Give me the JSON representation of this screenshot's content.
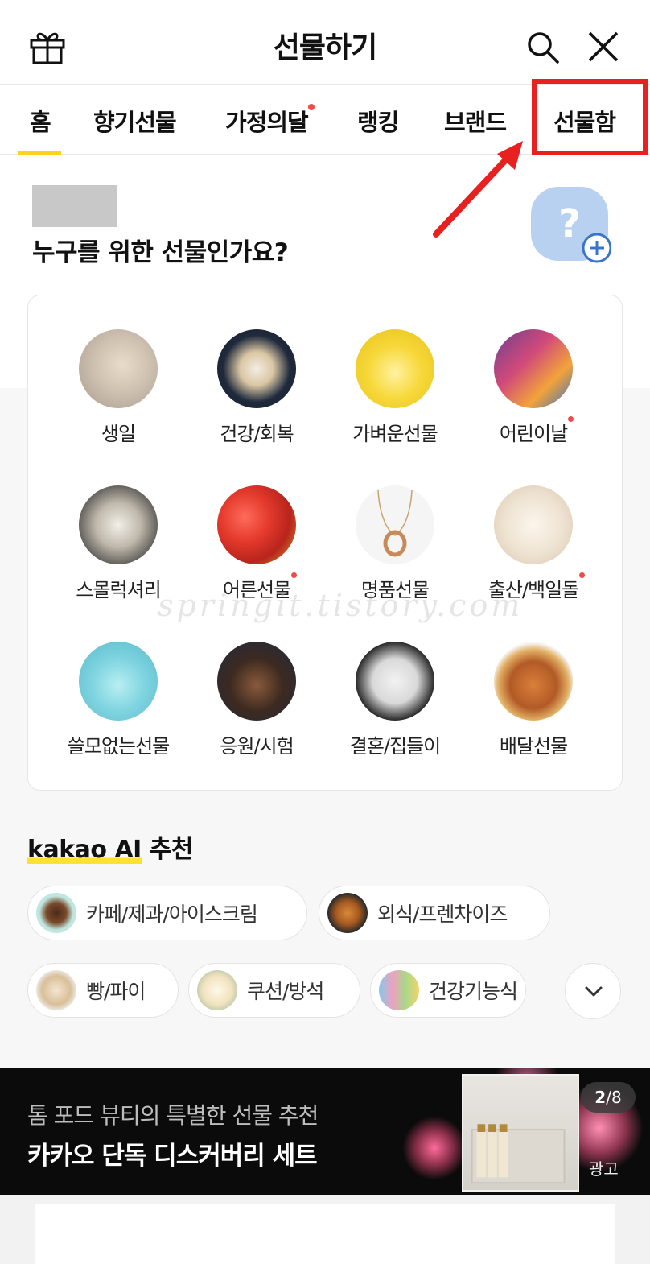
{
  "header": {
    "title": "선물하기"
  },
  "tabs": [
    {
      "label": "홈"
    },
    {
      "label": "향기선물"
    },
    {
      "label": "가정의달"
    },
    {
      "label": "랭킹"
    },
    {
      "label": "브랜드"
    },
    {
      "label": "선물함"
    }
  ],
  "who": {
    "question": "누구를 위한 선물인가요?"
  },
  "categories": [
    {
      "label": "생일"
    },
    {
      "label": "건강/회복"
    },
    {
      "label": "가벼운선물"
    },
    {
      "label": "어린이날"
    },
    {
      "label": "스몰럭셔리"
    },
    {
      "label": "어른선물"
    },
    {
      "label": "명품선물"
    },
    {
      "label": "출산/백일돌"
    },
    {
      "label": "쓸모없는선물"
    },
    {
      "label": "응원/시험"
    },
    {
      "label": "결혼/집들이"
    },
    {
      "label": "배달선물"
    }
  ],
  "watermark": "springit.tistory.com",
  "ai": {
    "brand": "kakao AI",
    "suffix": " 추천",
    "chips": [
      {
        "label": "카페/제과/아이스크림"
      },
      {
        "label": "외식/프렌차이즈"
      },
      {
        "label": "빵/파이"
      },
      {
        "label": "쿠션/방석"
      },
      {
        "label": "건강기능식"
      }
    ]
  },
  "banner": {
    "subtitle": "톰 포드 뷰티의 특별한 선물 추천",
    "title": "카카오 단독 디스커버리 세트",
    "page_current": "2",
    "page_total": "/8",
    "ad_label": "광고"
  },
  "colors": {
    "accent_yellow": "#ffd21e",
    "alert_red": "#e8201f",
    "new_dot": "#f04a4a"
  }
}
